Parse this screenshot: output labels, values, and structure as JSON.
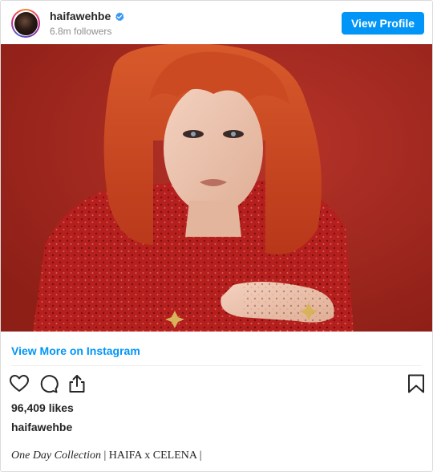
{
  "header": {
    "username": "haifawehbe",
    "followers": "6.8m followers",
    "view_profile_label": "View Profile",
    "verified_icon": "verified-badge-icon",
    "colors": {
      "accent": "#0095f6",
      "muted": "#8e8e8e"
    }
  },
  "photo": {
    "background_color": "#a4281d",
    "hair_color": "#c94620",
    "dress_color": "#b51f1d"
  },
  "links": {
    "view_more": "View More on Instagram"
  },
  "actions": {
    "icons": [
      "heart-icon",
      "comment-icon",
      "share-icon",
      "bookmark-icon"
    ]
  },
  "post": {
    "likes": "96,409 likes",
    "caption_user": "haifawehbe",
    "caption_italic": "One Day Collection",
    "caption_rest": " | HAIFA x CELENA |"
  }
}
